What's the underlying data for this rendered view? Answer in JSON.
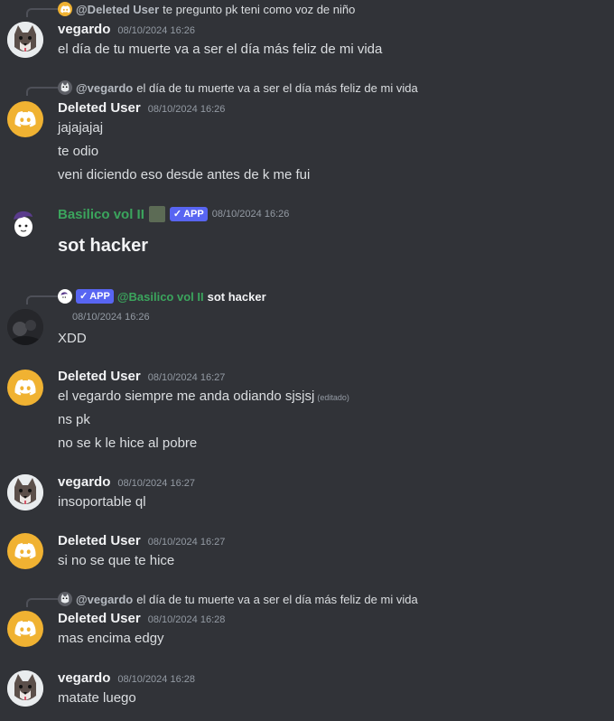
{
  "messages": [
    {
      "reply": {
        "user": "@Deleted User",
        "text": "te pregunto pk teni como voz de niño"
      },
      "author": "vegardo",
      "timestamp": "08/10/2024 16:26",
      "lines": [
        "el día de tu muerte va a ser el día más feliz de mi vida"
      ]
    },
    {
      "reply": {
        "user": "@vegardo",
        "text": "el día de tu muerte va a ser el día más feliz de mi vida"
      },
      "author": "Deleted User",
      "timestamp": "08/10/2024 16:26",
      "lines": [
        "jajajajaj",
        "te odio",
        "veni diciendo eso desde antes de k me fui"
      ]
    },
    {
      "author": "Basilico vol II",
      "badge": "APP",
      "timestamp": "08/10/2024 16:26",
      "lines": [
        "sot hacker"
      ]
    },
    {
      "reply": {
        "badge": "APP",
        "user": "@Basilico vol II",
        "text": "sot hacker"
      },
      "timestamp": "08/10/2024 16:26",
      "lines": [
        "XDD"
      ]
    },
    {
      "author": "Deleted User",
      "timestamp": "08/10/2024 16:27",
      "lines": [
        "el vegardo siempre me anda odiando sjsjsj",
        "ns pk",
        "no se k le hice al pobre"
      ],
      "edited": "(editado)"
    },
    {
      "author": "vegardo",
      "timestamp": "08/10/2024 16:27",
      "lines": [
        "insoportable ql"
      ]
    },
    {
      "author": "Deleted User",
      "timestamp": "08/10/2024 16:27",
      "lines": [
        "si no se que te hice"
      ]
    },
    {
      "reply": {
        "user": "@vegardo",
        "text": "el día de tu muerte va a ser el día más feliz de mi vida"
      },
      "author": "Deleted User",
      "timestamp": "08/10/2024 16:28",
      "lines": [
        "mas encima edgy"
      ]
    },
    {
      "author": "vegardo",
      "timestamp": "08/10/2024 16:28",
      "lines": [
        "matate luego"
      ]
    }
  ],
  "colors": {
    "background": "#313338",
    "discord_avatar": "#f0b232",
    "bot_name": "#3ba55d",
    "app_badge": "#5865f2"
  },
  "icons": {
    "discord_avatar": "discord-logo-icon",
    "wolf_avatar": "wolf-avatar",
    "bot_avatar": "basil-avatar",
    "check": "check-icon"
  }
}
